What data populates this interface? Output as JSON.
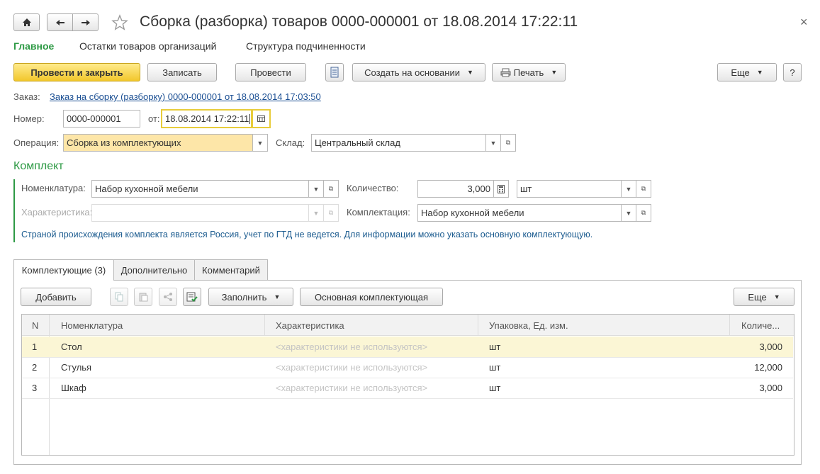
{
  "window": {
    "title": "Сборка (разборка) товаров 0000-000001 от 18.08.2014 17:22:11",
    "close_glyph": "×"
  },
  "nav_tabs": [
    "Главное",
    "Остатки товаров организаций",
    "Структура подчиненности"
  ],
  "toolbar": {
    "post_close": "Провести и закрыть",
    "save": "Записать",
    "post": "Провести",
    "create_based": "Создать на основании",
    "print": "Печать",
    "more": "Еще",
    "help": "?"
  },
  "order": {
    "label": "Заказ:",
    "link": "Заказ на сборку (разборку) 0000-000001 от 18.08.2014 17:03:50"
  },
  "number": {
    "label": "Номер:",
    "value": "0000-000001",
    "date_label": "от:",
    "date_value": "18.08.2014 17:22:11"
  },
  "operation": {
    "label": "Операция:",
    "value": "Сборка из комплектующих"
  },
  "warehouse": {
    "label": "Склад:",
    "value": "Центральный склад"
  },
  "kit": {
    "title": "Комплект",
    "nomenclature_label": "Номенклатура:",
    "nomenclature_value": "Набор кухонной мебели",
    "characteristic_label": "Характеристика:",
    "characteristic_value": "",
    "quantity_label": "Количество:",
    "quantity_value": "3,000",
    "unit_value": "шт",
    "config_label": "Комплектация:",
    "config_value": "Набор кухонной мебели",
    "note": "Страной происхождения комплекта является Россия, учет по ГТД не ведется. Для информации можно указать основную комплектующую."
  },
  "tabs": [
    "Комплектующие (3)",
    "Дополнительно",
    "Комментарий"
  ],
  "grid_toolbar": {
    "add": "Добавить",
    "fill": "Заполнить",
    "main_component": "Основная комплектующая",
    "more": "Еще"
  },
  "grid": {
    "columns": [
      "N",
      "Номенклатура",
      "Характеристика",
      "Упаковка, Ед. изм.",
      "Количе..."
    ],
    "rows": [
      {
        "n": "1",
        "name": "Стол",
        "characteristic": "<характеристики не используются>",
        "unit": "шт",
        "qty": "3,000"
      },
      {
        "n": "2",
        "name": "Стулья",
        "characteristic": "<характеристики не используются>",
        "unit": "шт",
        "qty": "12,000"
      },
      {
        "n": "3",
        "name": "Шкаф",
        "characteristic": "<характеристики не используются>",
        "unit": "шт",
        "qty": "3,000"
      }
    ]
  },
  "colors": {
    "accent_green": "#2e9a45",
    "link_blue": "#1b4f93",
    "selected_row": "#fbf6d5",
    "primary_button": "#f2c72c"
  }
}
